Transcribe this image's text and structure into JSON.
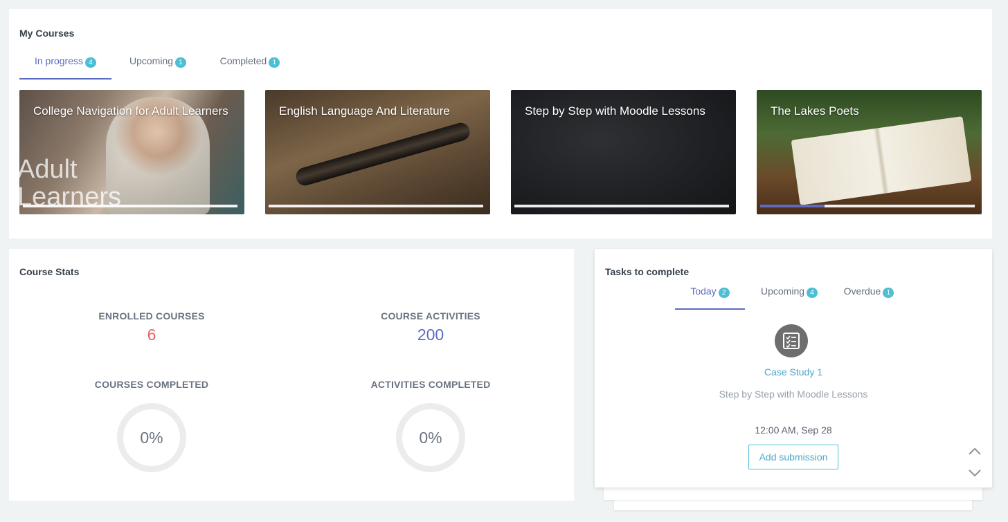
{
  "my_courses": {
    "title": "My Courses",
    "tabs": [
      {
        "label": "In progress",
        "count": "4"
      },
      {
        "label": "Upcoming",
        "count": "1"
      },
      {
        "label": "Completed",
        "count": "1"
      }
    ],
    "courses": [
      {
        "title": "College Navigation for Adult Learners",
        "image_text": "Adult\nLearners",
        "progress": 0
      },
      {
        "title": "English Language And Literature",
        "progress": 0
      },
      {
        "title": "Step by Step with Moodle Lessons",
        "progress": 0
      },
      {
        "title": "The Lakes Poets",
        "progress": 0.3
      }
    ]
  },
  "course_stats": {
    "title": "Course Stats",
    "enrolled_label": "ENROLLED COURSES",
    "enrolled_value": "6",
    "activities_label": "COURSE ACTIVITIES",
    "activities_value": "200",
    "courses_completed_label": "COURSES COMPLETED",
    "courses_completed_value": "0%",
    "activities_completed_label": "ACTIVITIES COMPLETED",
    "activities_completed_value": "0%"
  },
  "tasks": {
    "title": "Tasks to complete",
    "tabs": [
      {
        "label": "Today",
        "count": "2"
      },
      {
        "label": "Upcoming",
        "count": "4"
      },
      {
        "label": "Overdue",
        "count": "1"
      }
    ],
    "current": {
      "icon": "assignment-checklist-icon",
      "name": "Case Study 1",
      "course": "Step by Step with Moodle Lessons",
      "due": "12:00 AM, Sep 28",
      "action_label": "Add submission"
    }
  },
  "colors": {
    "accent": "#5c6bc0",
    "badge": "#4dbfd5",
    "enrolled_value": "#e75f63",
    "link": "#4aa7c9"
  }
}
